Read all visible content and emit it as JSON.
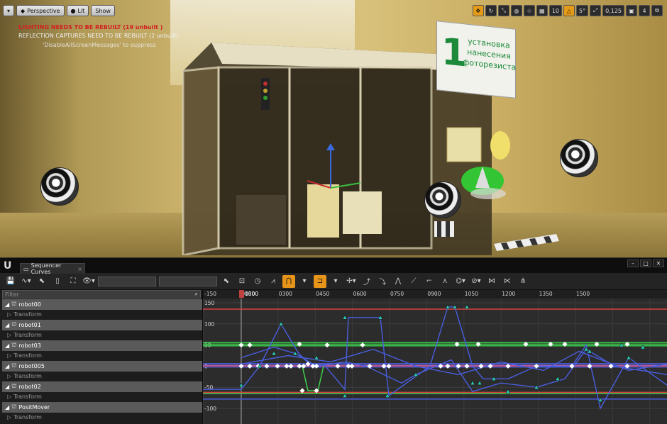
{
  "viewport": {
    "perspective_label": "Perspective",
    "lit_label": "Lit",
    "show_label": "Show",
    "messages": {
      "lighting": "LIGHTING NEEDS TO BE REBUILT (19 unbuilt )",
      "reflection": "REFLECTION CAPTURES NEED TO BE REBUILT (2 unbuilt)",
      "suppress": "'DisableAllScreenMessages' to suppress"
    },
    "grid_snap_value": "10",
    "rotation_snap_value": "5°",
    "scale_snap_value": "0,125",
    "camera_speed": "4",
    "sign": {
      "number": "1",
      "text": "установка нанесения фоторезиста"
    }
  },
  "sequencer": {
    "tab_label": "Sequencer Curves",
    "filter_placeholder": "Filter",
    "playhead_label": "0000",
    "tracks": [
      {
        "name": "robot00",
        "sub": "Transform"
      },
      {
        "name": "robot01",
        "sub": "Transform"
      },
      {
        "name": "robot03",
        "sub": "Transform"
      },
      {
        "name": "robot005",
        "sub": "Transform"
      },
      {
        "name": "robot02",
        "sub": "Transform"
      },
      {
        "name": "PositMover",
        "sub": "Transform"
      }
    ],
    "time_ticks": [
      "-150",
      "0150",
      "0300",
      "0450",
      "0600",
      "0750",
      "0900",
      "1050",
      "1200",
      "1350",
      "1500"
    ],
    "value_ticks": [
      "150",
      "100",
      "50",
      "0",
      "-50",
      "-100"
    ]
  },
  "colors": {
    "accent": "#e6941a",
    "curve_red": "#d94040",
    "curve_green": "#3bd04a",
    "curve_blue": "#4a5ee0",
    "key_teal": "#2ec8b0"
  }
}
